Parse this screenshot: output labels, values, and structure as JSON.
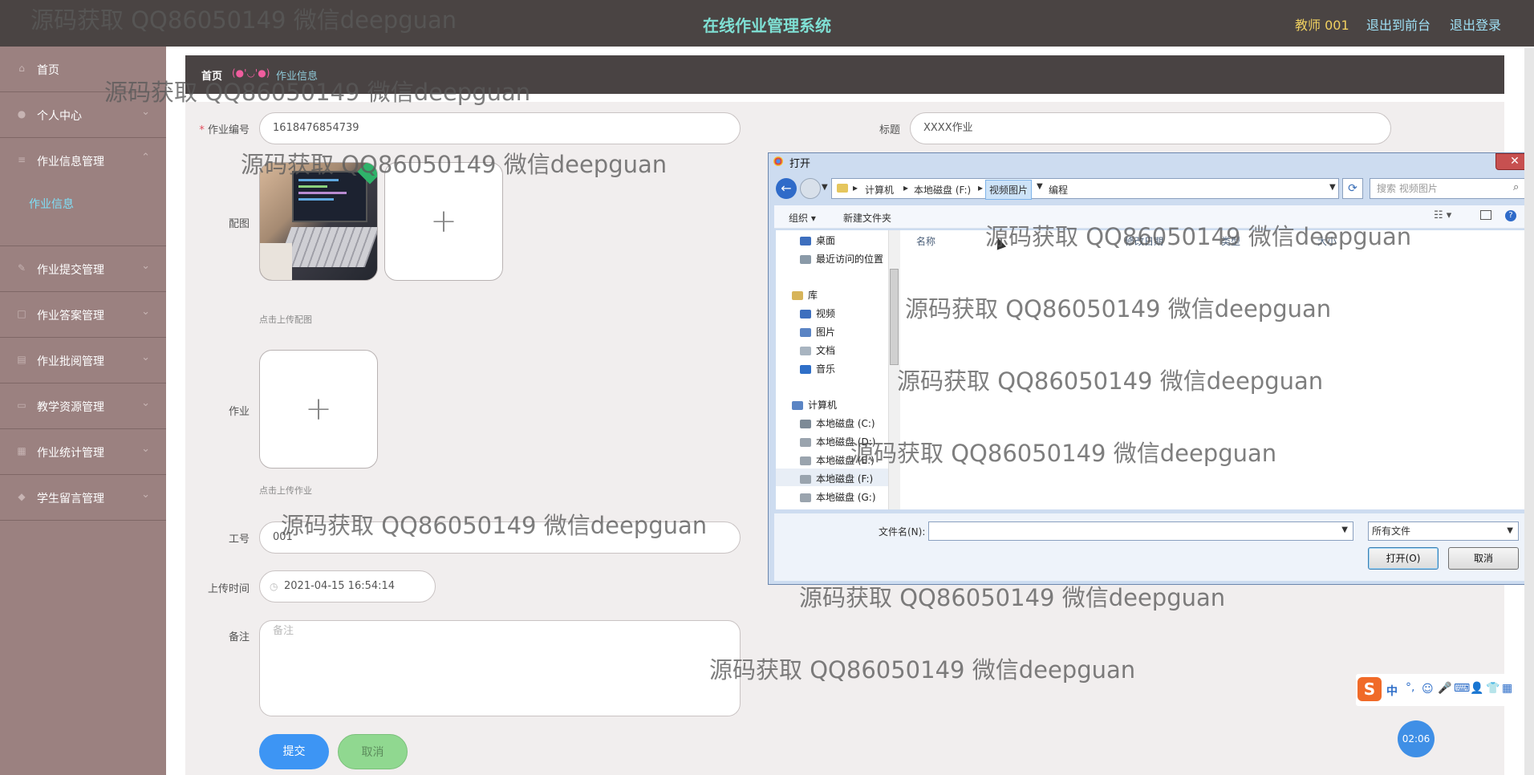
{
  "header": {
    "title": "在线作业管理系统",
    "user": "教师 001",
    "links": [
      "退出到前台",
      "退出登录"
    ]
  },
  "sidebar": {
    "items": [
      {
        "label": "首页",
        "icon": "home-icon"
      },
      {
        "label": "个人中心",
        "icon": "user-icon"
      },
      {
        "label": "作业信息管理",
        "icon": "list-icon"
      },
      {
        "label": "作业提交管理",
        "icon": "edit-icon"
      },
      {
        "label": "作业答案管理",
        "icon": "doc-icon"
      },
      {
        "label": "作业批阅管理",
        "icon": "check-icon"
      },
      {
        "label": "教学资源管理",
        "icon": "folder-icon"
      },
      {
        "label": "作业统计管理",
        "icon": "chart-icon"
      },
      {
        "label": "学生留言管理",
        "icon": "message-icon"
      }
    ],
    "sub_item": "作业信息"
  },
  "breadcrumb": {
    "home": "首页",
    "emoji": "(●'◡'●)",
    "current": "作业信息"
  },
  "form": {
    "number_label": "作业编号",
    "required_mark": "*",
    "number_value": "1618476854739",
    "title_label": "标题",
    "title_value": "XXXX作业",
    "image_label": "配图",
    "image_hint": "点击上传配图",
    "homework_label": "作业",
    "homework_hint": "点击上传作业",
    "jobno_label": "工号",
    "jobno_value": "001",
    "time_label": "上传时间",
    "time_value": "2021-04-15 16:54:14",
    "note_label": "备注",
    "note_placeholder": "备注",
    "submit": "提交",
    "cancel": "取消"
  },
  "dialog": {
    "title": "打开",
    "path": [
      "计算机",
      "本地磁盘 (F:)",
      "视频图片",
      "编程"
    ],
    "search_placeholder": "搜索 视频图片",
    "toolbar": {
      "organize": "组织 ▾",
      "new_folder": "新建文件夹"
    },
    "columns": [
      "名称",
      "修改日期",
      "类型",
      "大小"
    ],
    "tree": [
      {
        "label": "桌面",
        "color": "#3d6fbe"
      },
      {
        "label": "最近访问的位置",
        "color": "#8a9aa8"
      },
      {
        "label": "库",
        "color": "#d7b45a"
      },
      {
        "label": "视频",
        "color": "#3d6fbe"
      },
      {
        "label": "图片",
        "color": "#5a84c4"
      },
      {
        "label": "文档",
        "color": "#a8b4c0"
      },
      {
        "label": "音乐",
        "color": "#2f6fc8"
      },
      {
        "label": "计算机",
        "color": "#5a84c4"
      },
      {
        "label": "本地磁盘 (C:)",
        "color": "#7d8a96"
      },
      {
        "label": "本地磁盘 (D:)",
        "color": "#9aa4ae"
      },
      {
        "label": "本地磁盘 (E:)",
        "color": "#9aa4ae"
      },
      {
        "label": "本地磁盘 (F:)",
        "color": "#9aa4ae"
      },
      {
        "label": "本地磁盘 (G:)",
        "color": "#9aa4ae"
      }
    ],
    "filename_label": "文件名(N):",
    "filetype": "所有文件",
    "open": "打开(O)",
    "cancel": "取消"
  },
  "watermark": "源码获取 QQ86050149 微信deepguan",
  "clock": "02:06"
}
